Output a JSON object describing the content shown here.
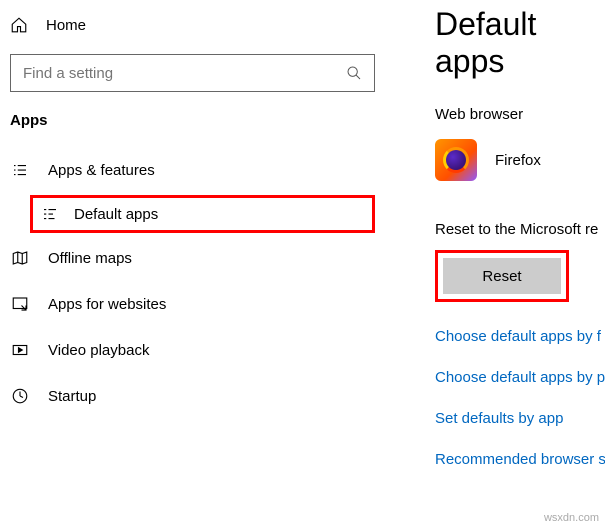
{
  "sidebar": {
    "home": "Home",
    "search_placeholder": "Find a setting",
    "section": "Apps",
    "items": [
      {
        "label": "Apps & features"
      },
      {
        "label": "Default apps"
      },
      {
        "label": "Offline maps"
      },
      {
        "label": "Apps for websites"
      },
      {
        "label": "Video playback"
      },
      {
        "label": "Startup"
      }
    ]
  },
  "main": {
    "title": "Default apps",
    "web_browser_label": "Web browser",
    "browser_name": "Firefox",
    "reset_label": "Reset to the Microsoft re",
    "reset_button": "Reset",
    "links": [
      "Choose default apps by f",
      "Choose default apps by p",
      "Set defaults by app",
      "Recommended browser s"
    ]
  },
  "watermark": "wsxdn.com"
}
